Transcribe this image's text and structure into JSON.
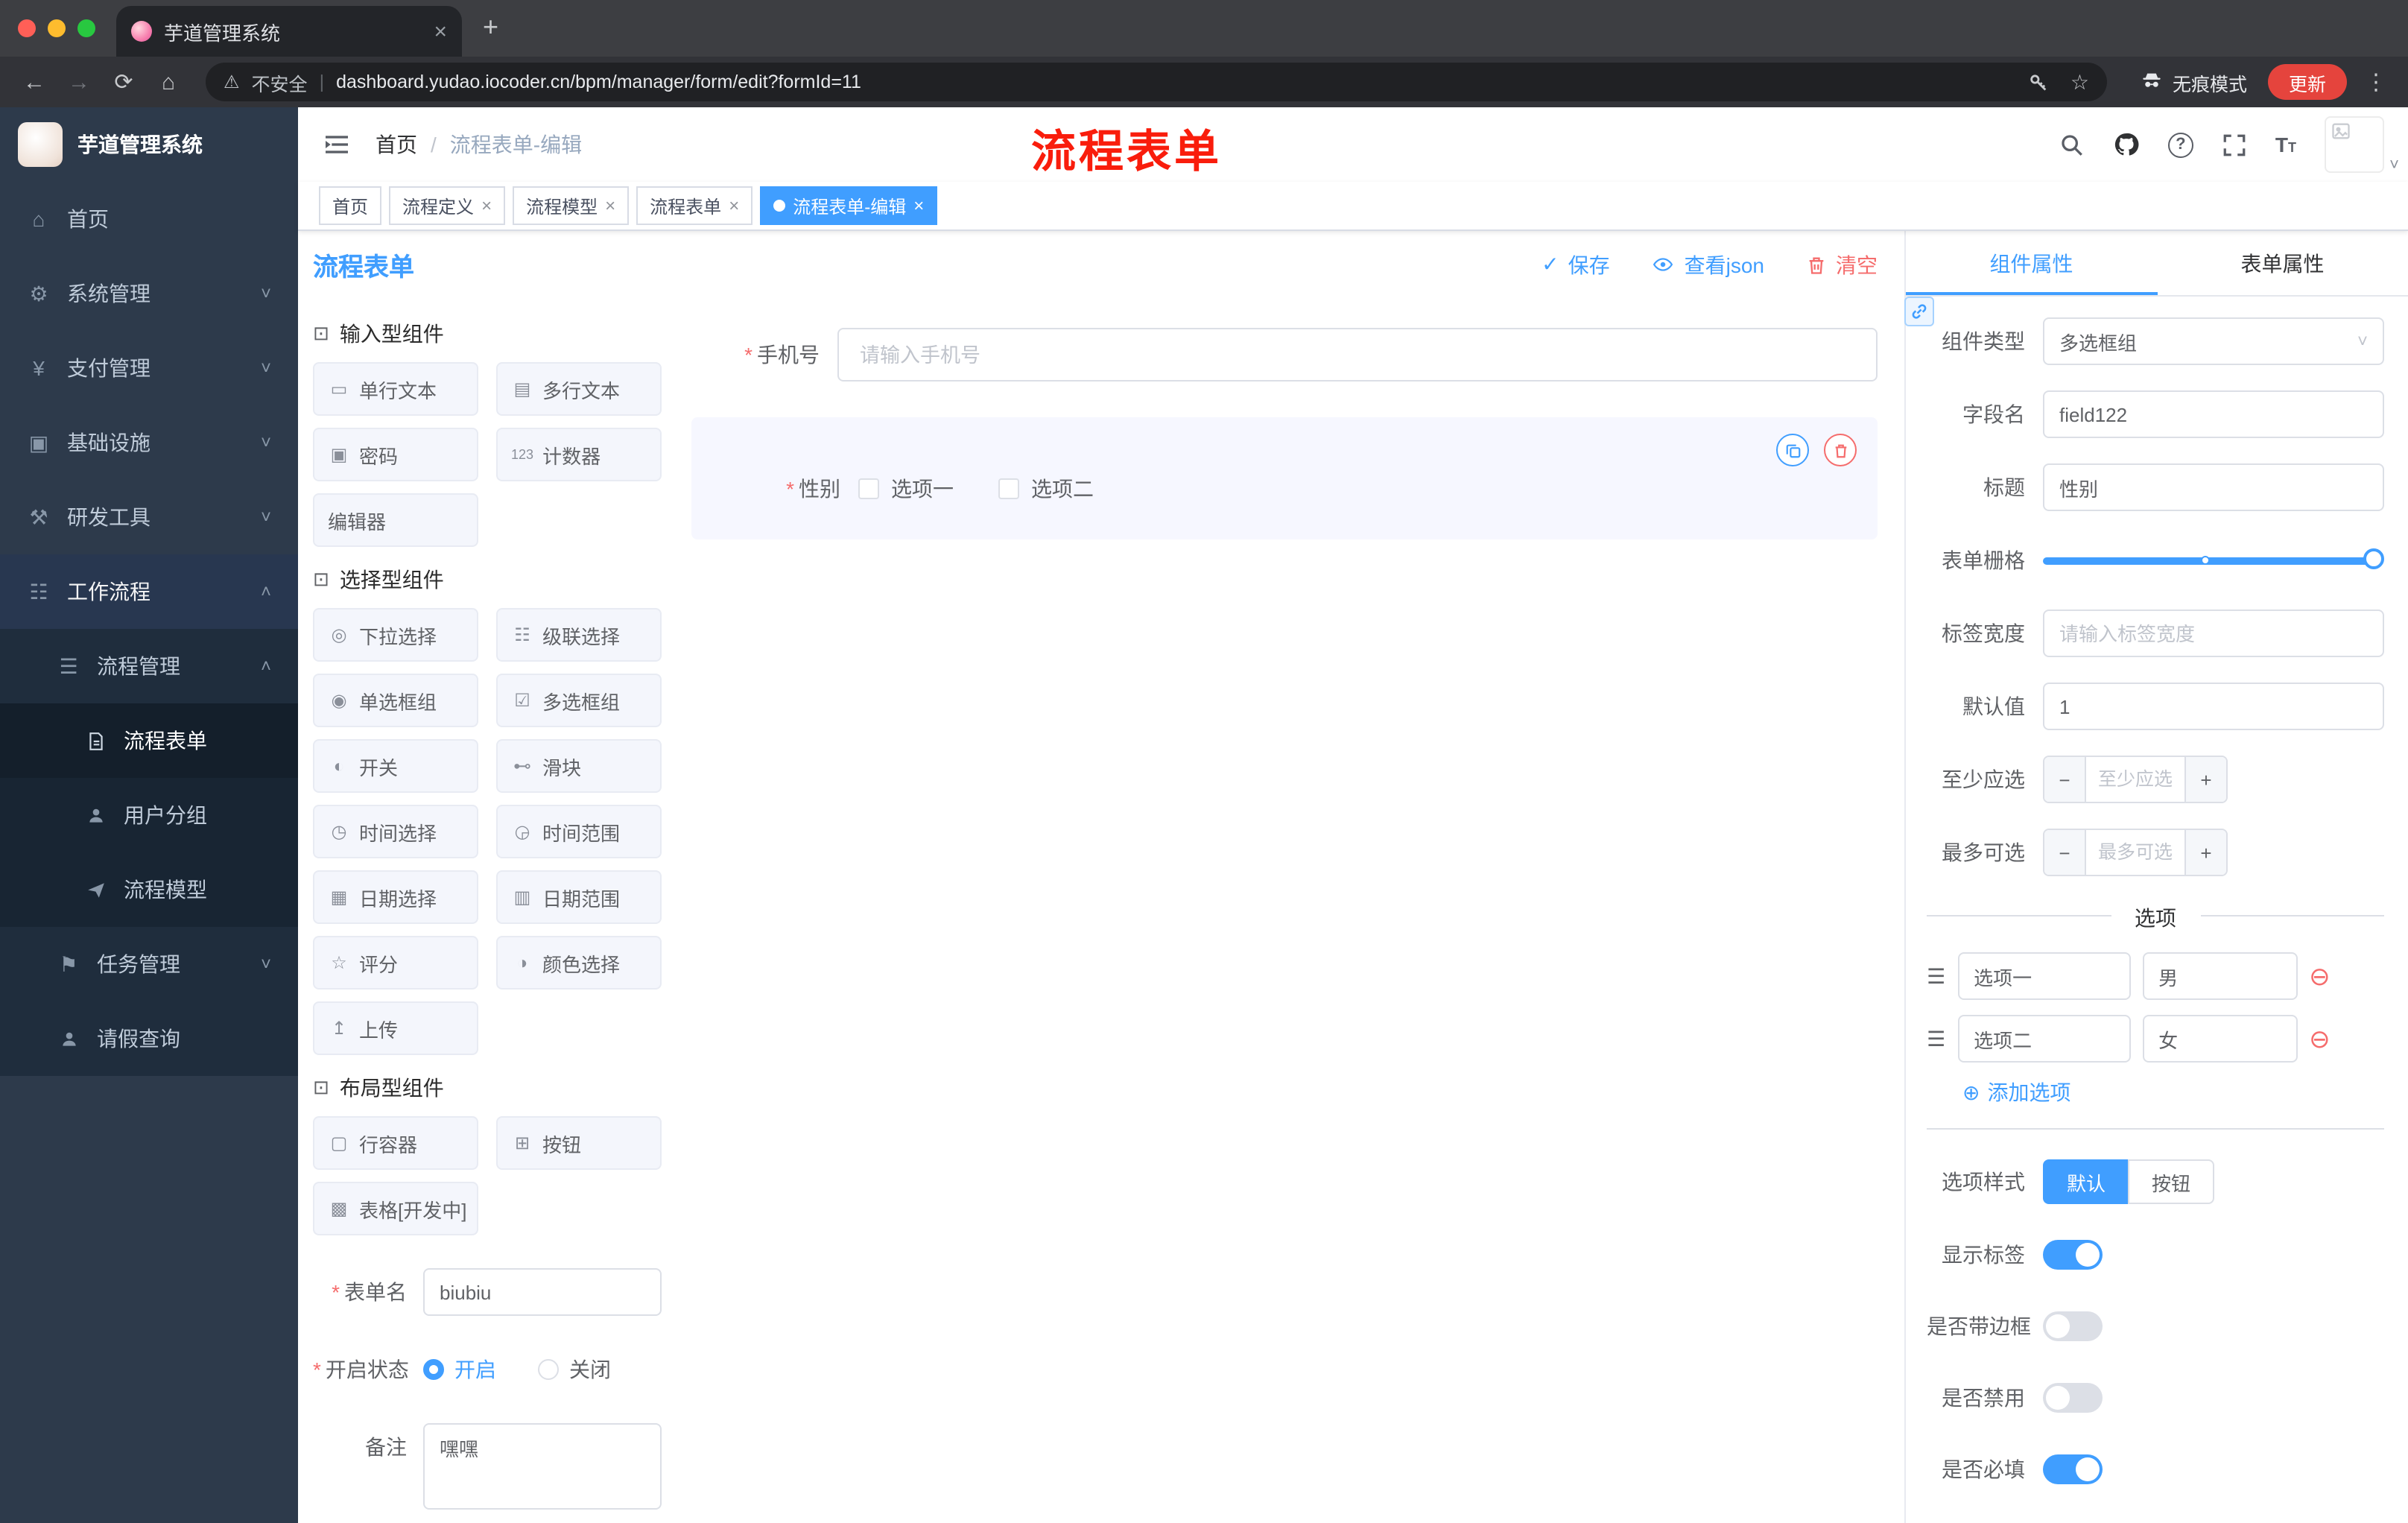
{
  "browser": {
    "tab_title": "芋道管理系统",
    "security_label": "不安全",
    "url": "dashboard.yudao.iocoder.cn/bpm/manager/form/edit?formId=11",
    "incognito_label": "无痕模式",
    "update_label": "更新"
  },
  "misc": {
    "required": "*"
  },
  "icons": {
    "close": "×",
    "plus": "+",
    "minus": "−",
    "back": "←",
    "forward": "→",
    "reload": "⟳",
    "home": "⌂",
    "star": "☆",
    "kebab": "⋮",
    "caret": "˅",
    "chevron_down": "˅",
    "chevron_up": "˄",
    "check": "✓",
    "plus_circle": "⊕",
    "minus_circle": "⊖",
    "warning": "⚠",
    "pipe": "|",
    "qmark": "?",
    "t_big": "T",
    "t_small": "T",
    "group": "⊡",
    "drag": "☰",
    "single_text": "▭",
    "multi_text": "▤",
    "password": "▣",
    "counter": "123",
    "select": "◎",
    "cascade": "☷",
    "radio_group": "◉",
    "checkbox_group": "☑",
    "switch": "◐",
    "slider": "⊷",
    "time": "◷",
    "time_range": "◶",
    "date": "▦",
    "date_range": "▥",
    "rate": "☆",
    "color": "◑",
    "upload": "↥",
    "row": "▢",
    "button": "⊞",
    "table": "▩",
    "m_home": "⌂",
    "m_system": "⚙",
    "m_pay": "¥",
    "m_infra": "▣",
    "m_tools": "⚒",
    "m_flow": "☷",
    "m_list": "☰",
    "m_flag": "⚑"
  },
  "sidebar": {
    "logo_title": "芋道管理系统",
    "menu": {
      "home": "首页",
      "system": "系统管理",
      "pay": "支付管理",
      "infra": "基础设施",
      "devtools": "研发工具",
      "workflow": "工作流程",
      "flow_manage": "流程管理",
      "flow_form": "流程表单",
      "user_group": "用户分组",
      "flow_model": "流程模型",
      "task_manage": "任务管理",
      "leave_query": "请假查询"
    }
  },
  "header": {
    "breadcrumb_home": "首页",
    "breadcrumb_sep": "/",
    "breadcrumb_current": "流程表单-编辑",
    "annotation": "流程表单"
  },
  "tags": [
    {
      "label": "首页"
    },
    {
      "label": "流程定义"
    },
    {
      "label": "流程模型"
    },
    {
      "label": "流程表单"
    },
    {
      "label": "流程表单-编辑"
    }
  ],
  "designer": {
    "title": "流程表单",
    "actions": {
      "save": "保存",
      "view_json": "查看json",
      "clear": "清空"
    },
    "groups": [
      {
        "title": "输入型组件",
        "items": [
          "单行文本",
          "多行文本",
          "密码",
          "计数器",
          "编辑器"
        ]
      },
      {
        "title": "选择型组件",
        "items": [
          "下拉选择",
          "级联选择",
          "单选框组",
          "多选框组",
          "开关",
          "滑块",
          "时间选择",
          "时间范围",
          "日期选择",
          "日期范围",
          "评分",
          "颜色选择",
          "上传"
        ]
      },
      {
        "title": "布局型组件",
        "items": [
          "行容器",
          "按钮",
          "表格[开发中]"
        ]
      }
    ],
    "form": {
      "name_label": "表单名",
      "name_value": "biubiu",
      "status_label": "开启状态",
      "status_on": "开启",
      "status_off": "关闭",
      "remark_label": "备注",
      "remark_value": "嘿嘿"
    },
    "canvas": {
      "phone_label": "手机号",
      "phone_placeholder": "请输入手机号",
      "gender_label": "性别",
      "gender_options": [
        "选项一",
        "选项二"
      ]
    }
  },
  "props": {
    "tabs": [
      "组件属性",
      "表单属性"
    ],
    "fields": {
      "type_label": "组件类型",
      "type_value": "多选框组",
      "field_label": "字段名",
      "field_value": "field122",
      "title_label": "标题",
      "title_value": "性别",
      "grid_label": "表单栅格",
      "width_label": "标签宽度",
      "width_placeholder": "请输入标签宽度",
      "default_label": "默认值",
      "default_value": "1",
      "min_label": "至少应选",
      "min_placeholder": "至少应选",
      "max_label": "最多可选",
      "max_placeholder": "最多可选"
    },
    "options": {
      "title": "选项",
      "rows": [
        {
          "label": "选项一",
          "value": "男"
        },
        {
          "label": "选项二",
          "value": "女"
        }
      ],
      "add_label": "添加选项"
    },
    "style": {
      "label": "选项样式",
      "options": [
        "默认",
        "按钮"
      ]
    },
    "switches": [
      {
        "label": "显示标签"
      },
      {
        "label": "是否带边框"
      },
      {
        "label": "是否禁用"
      },
      {
        "label": "是否必填"
      }
    ]
  }
}
